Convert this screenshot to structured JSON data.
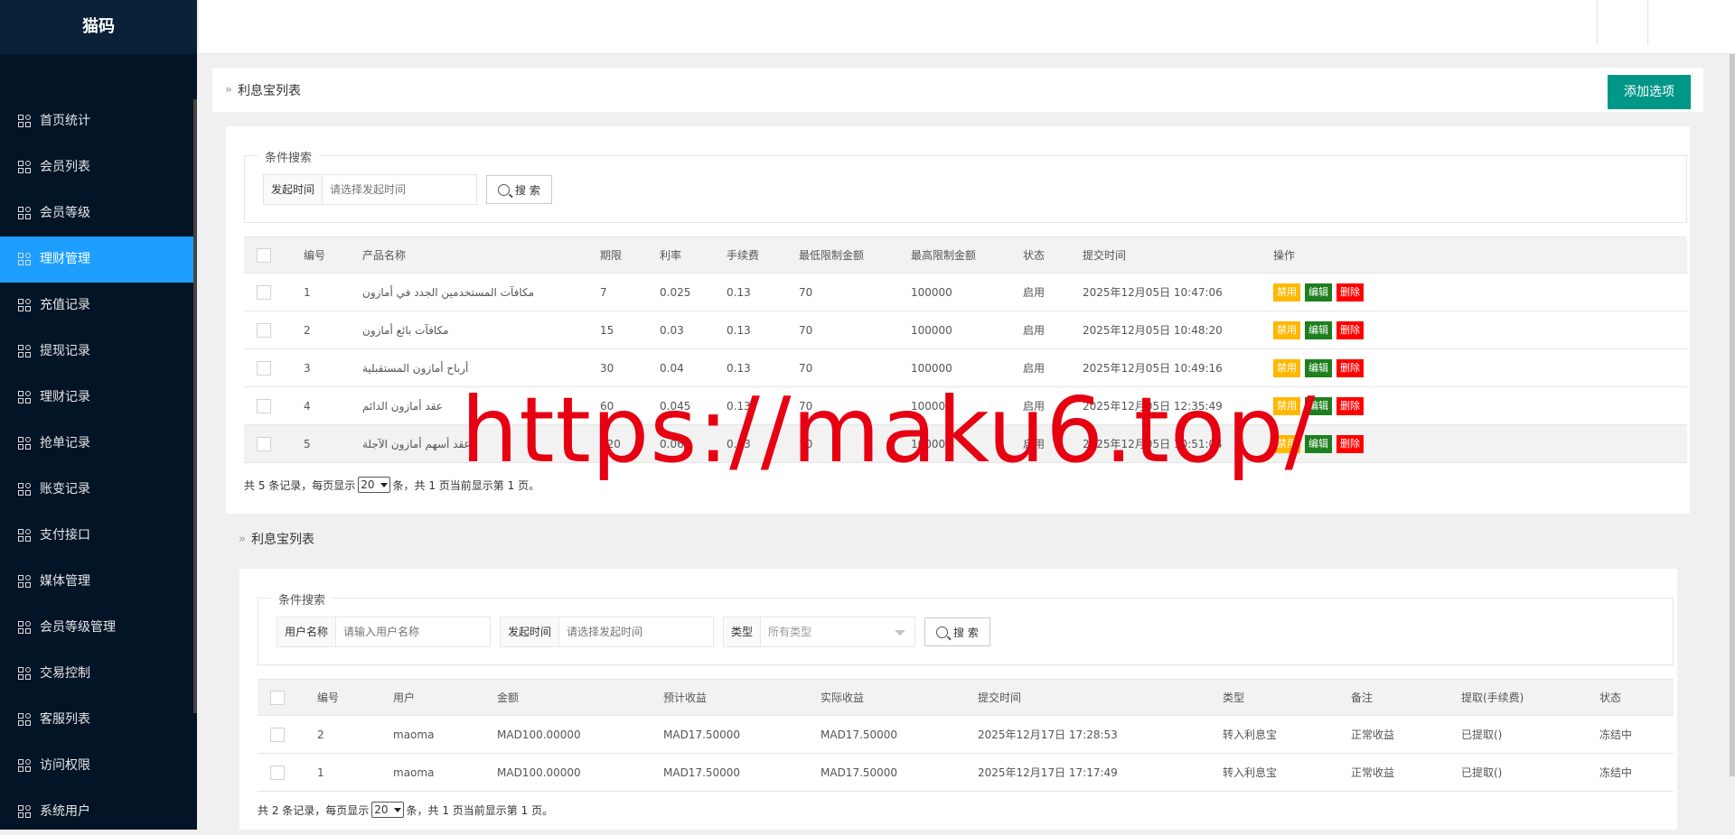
{
  "sidebar": {
    "brand": "猫码",
    "items": [
      {
        "label": "首页统计",
        "active": false
      },
      {
        "label": "会员列表",
        "active": false
      },
      {
        "label": "会员等级",
        "active": false
      },
      {
        "label": "理财管理",
        "active": true
      },
      {
        "label": "充值记录",
        "active": false
      },
      {
        "label": "提现记录",
        "active": false
      },
      {
        "label": "理财记录",
        "active": false
      },
      {
        "label": "抢单记录",
        "active": false
      },
      {
        "label": "账变记录",
        "active": false
      },
      {
        "label": "支付接口",
        "active": false
      },
      {
        "label": "媒体管理",
        "active": false
      },
      {
        "label": "会员等级管理",
        "active": false
      },
      {
        "label": "交易控制",
        "active": false
      },
      {
        "label": "客服列表",
        "active": false
      },
      {
        "label": "访问权限",
        "active": false
      },
      {
        "label": "系统用户",
        "active": false
      }
    ]
  },
  "section1": {
    "title": "利息宝列表",
    "add_button": "添加选项",
    "search_legend": "条件搜索",
    "time_label": "发起时间",
    "time_placeholder": "请选择发起时间",
    "search_button": "搜 索",
    "headers": [
      "编号",
      "产品名称",
      "期限",
      "利率",
      "手续费",
      "最低限制金额",
      "最高限制金额",
      "状态",
      "提交时间",
      "操作"
    ],
    "rows": [
      {
        "id": "1",
        "name": "مكافآت المستخدمين الجدد في أمازون",
        "term": "7",
        "rate": "0.025",
        "fee": "0.13",
        "min": "70",
        "max": "100000",
        "status": "启用",
        "time": "2025年12月05日 10:47:06"
      },
      {
        "id": "2",
        "name": "مكافآت بائع أمازون",
        "term": "15",
        "rate": "0.03",
        "fee": "0.13",
        "min": "70",
        "max": "100000",
        "status": "启用",
        "time": "2025年12月05日 10:48:20"
      },
      {
        "id": "3",
        "name": "أرباح أمازون المستقبلية",
        "term": "30",
        "rate": "0.04",
        "fee": "0.13",
        "min": "70",
        "max": "100000",
        "status": "启用",
        "time": "2025年12月05日 10:49:16"
      },
      {
        "id": "4",
        "name": "عقد أمازون الدائم",
        "term": "60",
        "rate": "0.045",
        "fee": "0.13",
        "min": "70",
        "max": "100000",
        "status": "启用",
        "time": "2025年12月05日 12:35:49"
      },
      {
        "id": "5",
        "name": "عقد أسهم أمازون الآجلة",
        "term": "120",
        "rate": "0.06",
        "fee": "0.13",
        "min": "70",
        "max": "100000",
        "status": "启用",
        "time": "2025年12月05日 10:51:04"
      }
    ],
    "ops": {
      "ban": "禁用",
      "edit": "编辑",
      "del": "删除"
    },
    "pager": {
      "prefix": "共 5 条记录，每页显示",
      "size": "20",
      "suffix": "条，共 1 页当前显示第 1 页。"
    }
  },
  "section2": {
    "title": "利息宝列表",
    "search_legend": "条件搜索",
    "user_label": "用户名称",
    "user_placeholder": "请输入用户名称",
    "time_label": "发起时间",
    "time_placeholder": "请选择发起时间",
    "type_label": "类型",
    "type_value": "所有类型",
    "search_button": "搜 索",
    "headers": [
      "编号",
      "用户",
      "金额",
      "预计收益",
      "实际收益",
      "提交时间",
      "类型",
      "备注",
      "提取(手续费)",
      "状态"
    ],
    "rows": [
      {
        "id": "2",
        "user": "maoma",
        "amount": "MAD100.00000",
        "expected": "MAD17.50000",
        "actual": "MAD17.50000",
        "time": "2025年12月17日 17:28:53",
        "type": "转入利息宝",
        "note": "正常收益",
        "withdraw": "已提取()",
        "status": "冻结中"
      },
      {
        "id": "1",
        "user": "maoma",
        "amount": "MAD100.00000",
        "expected": "MAD17.50000",
        "actual": "MAD17.50000",
        "time": "2025年12月17日 17:17:49",
        "type": "转入利息宝",
        "note": "正常收益",
        "withdraw": "已提取()",
        "status": "冻结中"
      }
    ],
    "pager": {
      "prefix": "共 2 条记录，每页显示",
      "size": "20",
      "suffix": "条，共 1 页当前显示第 1 页。"
    }
  },
  "watermark": "https://maku6.top/",
  "colors": {
    "sidebar": "#041427",
    "active": "#1e9fff",
    "add_button": "#009688",
    "ban": "#ffb800",
    "edit": "#1e7f1e",
    "del": "#ff0000",
    "watermark": "#e60012"
  }
}
